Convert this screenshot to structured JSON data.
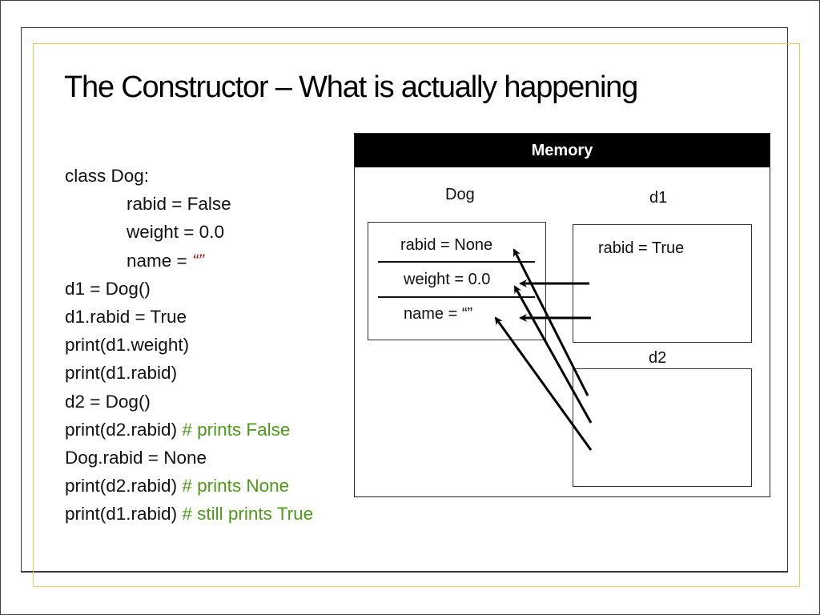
{
  "slide": {
    "title": "The Constructor – What is actually happening"
  },
  "code": {
    "lines": [
      {
        "text": "class Dog:",
        "comment": ""
      },
      {
        "text": "rabid = False",
        "comment": ""
      },
      {
        "text": "weight = 0.0",
        "comment": ""
      },
      {
        "text": "name = ",
        "string": "“”",
        "comment": ""
      },
      {
        "text": "d1 = Dog()",
        "comment": ""
      },
      {
        "text": "d1.rabid = True",
        "comment": ""
      },
      {
        "text": "print(d1.weight)",
        "comment": ""
      },
      {
        "text": "print(d1.rabid)",
        "comment": ""
      },
      {
        "text": "d2 = Dog()",
        "comment": ""
      },
      {
        "text": "print(d2.rabid) ",
        "comment": "# prints False"
      },
      {
        "text": "Dog.rabid = None",
        "comment": ""
      },
      {
        "text": "print(d2.rabid) ",
        "comment": "# prints None"
      },
      {
        "text": "print(d1.rabid) ",
        "comment": "# still prints True"
      }
    ]
  },
  "memory": {
    "header": "Memory",
    "dog": {
      "label": "Dog",
      "attrs": [
        "rabid = None",
        "weight = 0.0",
        "name = “”"
      ]
    },
    "d1": {
      "label": "d1",
      "attrs": [
        "rabid = True"
      ]
    },
    "d2": {
      "label": "d2",
      "attrs": []
    },
    "references": [
      {
        "from": "d1",
        "to": "Dog.weight"
      },
      {
        "from": "d1",
        "to": "Dog.name"
      },
      {
        "from": "d2",
        "to": "Dog.rabid"
      },
      {
        "from": "d2",
        "to": "Dog.weight"
      },
      {
        "from": "d2",
        "to": "Dog.name"
      }
    ]
  },
  "colors": {
    "comment": "#4e9a1a",
    "string": "#b5171d",
    "gold_border": "#f2c75a"
  }
}
